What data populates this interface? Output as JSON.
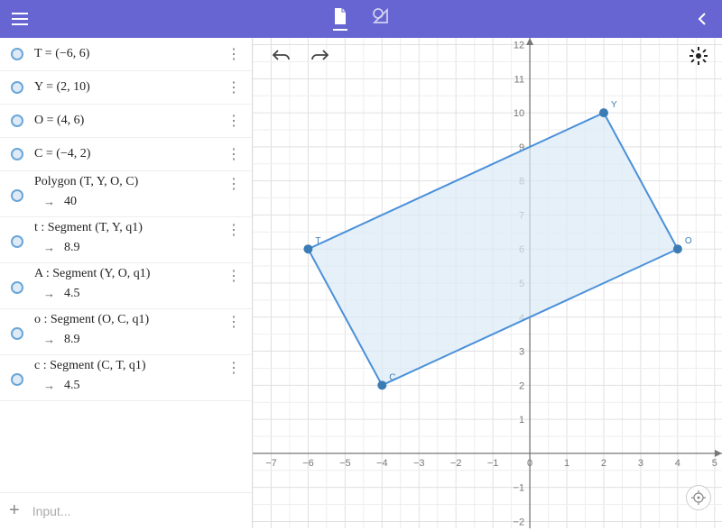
{
  "header": {
    "menu_icon": "menu",
    "tab_algebra_icon": "document",
    "tab_tools_icon": "triangle-ruler",
    "collapse_icon": "chevron-left"
  },
  "sidebar": {
    "items": [
      {
        "def": "T = (−6, 6)",
        "result": null
      },
      {
        "def": "Y = (2, 10)",
        "result": null
      },
      {
        "def": "O = (4, 6)",
        "result": null
      },
      {
        "def": "C = (−4, 2)",
        "result": null
      },
      {
        "def": "Polygon (T, Y, O, C)",
        "result": "40"
      },
      {
        "def": "t : Segment (T, Y, q1)",
        "result": "8.9"
      },
      {
        "def": "A : Segment (Y, O, q1)",
        "result": "4.5"
      },
      {
        "def": "o : Segment (O, C, q1)",
        "result": "8.9"
      },
      {
        "def": "c : Segment (C, T, q1)",
        "result": "4.5"
      }
    ],
    "input_placeholder": "Input..."
  },
  "canvas": {
    "undo_icon": "undo",
    "redo_icon": "redo",
    "settings_icon": "gear",
    "locate_icon": "locate"
  },
  "chart_data": {
    "type": "scatter",
    "title": "",
    "xlabel": "",
    "ylabel": "",
    "xlim": [
      -7.5,
      5.2
    ],
    "ylim": [
      -2.2,
      12.2
    ],
    "x_ticks": [
      -7,
      -6,
      -5,
      -4,
      -3,
      -2,
      -1,
      0,
      1,
      2,
      3,
      4,
      5
    ],
    "y_ticks": [
      -2,
      -1,
      1,
      2,
      3,
      4,
      5,
      6,
      7,
      8,
      9,
      10,
      11,
      12
    ],
    "points": [
      {
        "name": "T",
        "x": -6,
        "y": 6
      },
      {
        "name": "Y",
        "x": 2,
        "y": 10
      },
      {
        "name": "O",
        "x": 4,
        "y": 6
      },
      {
        "name": "C",
        "x": -4,
        "y": 2
      }
    ],
    "polygon": [
      "T",
      "Y",
      "O",
      "C"
    ],
    "polygon_area": 40,
    "segments": [
      {
        "name": "t",
        "from": "T",
        "to": "Y",
        "length": 8.9
      },
      {
        "name": "A",
        "from": "Y",
        "to": "O",
        "length": 4.5
      },
      {
        "name": "o",
        "from": "O",
        "to": "C",
        "length": 8.9
      },
      {
        "name": "c",
        "from": "C",
        "to": "T",
        "length": 4.5
      }
    ]
  }
}
